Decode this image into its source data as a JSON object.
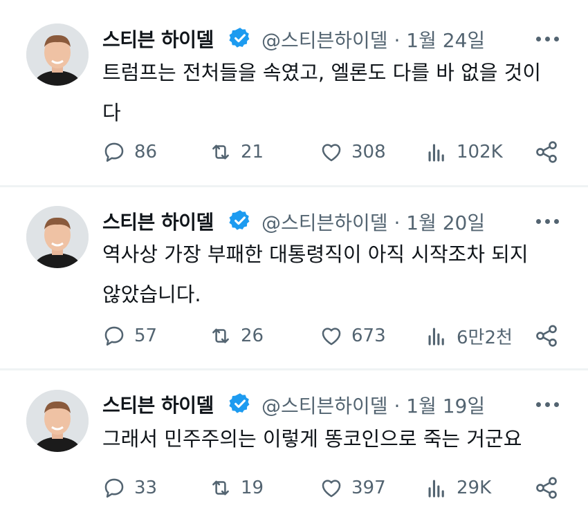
{
  "tweets": [
    {
      "name": "스티븐 하이델",
      "handle_date": "@스티븐하이델 · 1월 24일",
      "text": "트럼프는 전처들을 속였고, 엘론도 다를 바 없을 것이\n다",
      "replies": "86",
      "retweets": "21",
      "likes": "308",
      "views": "102K"
    },
    {
      "name": "스티븐 하이델",
      "handle_date": "@스티븐하이델 · 1월 20일",
      "text": "역사상 가장 부패한 대통령직이 아직 시작조차 되지\n않았습니다.",
      "replies": "57",
      "retweets": "26",
      "likes": "673",
      "views": "6만2천"
    },
    {
      "name": "스티븐 하이델",
      "handle_date": "@스티븐하이델 · 1월 19일",
      "text": "그래서 민주주의는 이렇게 똥코인으로 죽는 거군요",
      "replies": "33",
      "retweets": "19",
      "likes": "397",
      "views": "29K"
    }
  ],
  "icons": {
    "avatar": "profile-photo-icon",
    "verified": "verified-badge-icon",
    "more": "more-options-icon",
    "reply": "reply-icon",
    "retweet": "retweet-icon",
    "like": "heart-icon",
    "views": "views-chart-icon",
    "share": "share-icon"
  },
  "colors": {
    "text": "#0f1419",
    "secondary": "#536471",
    "verified": "#1d9bf0",
    "divider": "#eff3f4"
  }
}
